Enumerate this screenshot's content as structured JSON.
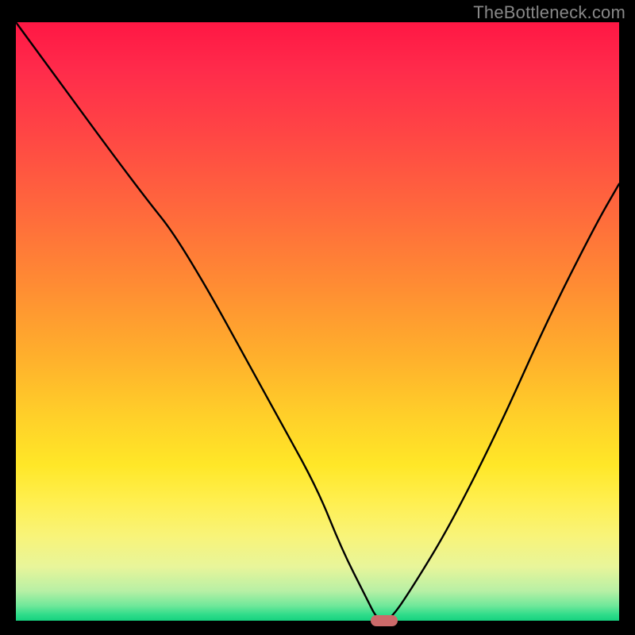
{
  "watermark": "TheBottleneck.com",
  "colors": {
    "frame": "#000000",
    "curve": "#000000",
    "marker": "#cc6a6a",
    "gradient_stops": [
      "#ff1744",
      "#ff4445",
      "#ff8c33",
      "#ffd029",
      "#ffef4f",
      "#b8f0a5",
      "#16d27f"
    ]
  },
  "chart_data": {
    "type": "line",
    "title": "",
    "xlabel": "",
    "ylabel": "",
    "xlim": [
      0,
      100
    ],
    "ylim": [
      0,
      100
    ],
    "grid": false,
    "legend": false,
    "series": [
      {
        "name": "bottleneck-curve",
        "x": [
          0,
          8,
          16,
          22,
          26,
          32,
          38,
          44,
          50,
          54,
          58,
          60,
          62,
          66,
          72,
          80,
          88,
          96,
          100
        ],
        "values": [
          100,
          89,
          78,
          70,
          65,
          55,
          44,
          33,
          22,
          12,
          4,
          0,
          0,
          6,
          16,
          32,
          50,
          66,
          73
        ]
      }
    ],
    "marker": {
      "x": 61,
      "y": 0,
      "width_frac": 0.045
    }
  }
}
